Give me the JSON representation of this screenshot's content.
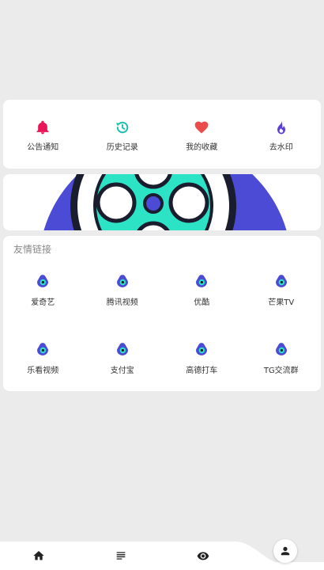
{
  "quick_actions": [
    {
      "label": "公告通知",
      "icon": "bell-icon",
      "color": "#e8155a"
    },
    {
      "label": "历史记录",
      "icon": "history-icon",
      "color": "#1bbfb1"
    },
    {
      "label": "我的收藏",
      "icon": "heart-icon",
      "color": "#ea4c4c"
    },
    {
      "label": "去水印",
      "icon": "flame-icon",
      "color": "#5b3fd6"
    }
  ],
  "banner": {
    "icon": "film-reel-icon",
    "colors": {
      "primary": "#4b4bd6",
      "reel": "#2de3c6",
      "dark": "#1a1d2e"
    }
  },
  "links": {
    "title": "友情链接",
    "items": [
      {
        "label": "爱奇艺"
      },
      {
        "label": "腾讯视频"
      },
      {
        "label": "优酷"
      },
      {
        "label": "芒果TV"
      },
      {
        "label": "乐看视频"
      },
      {
        "label": "支付宝"
      },
      {
        "label": "高德打车"
      },
      {
        "label": "TG交流群"
      }
    ]
  },
  "tabbar": {
    "tabs": [
      {
        "icon": "home-icon"
      },
      {
        "icon": "list-icon"
      },
      {
        "icon": "eye-icon"
      },
      {
        "icon": "user-icon"
      }
    ]
  }
}
